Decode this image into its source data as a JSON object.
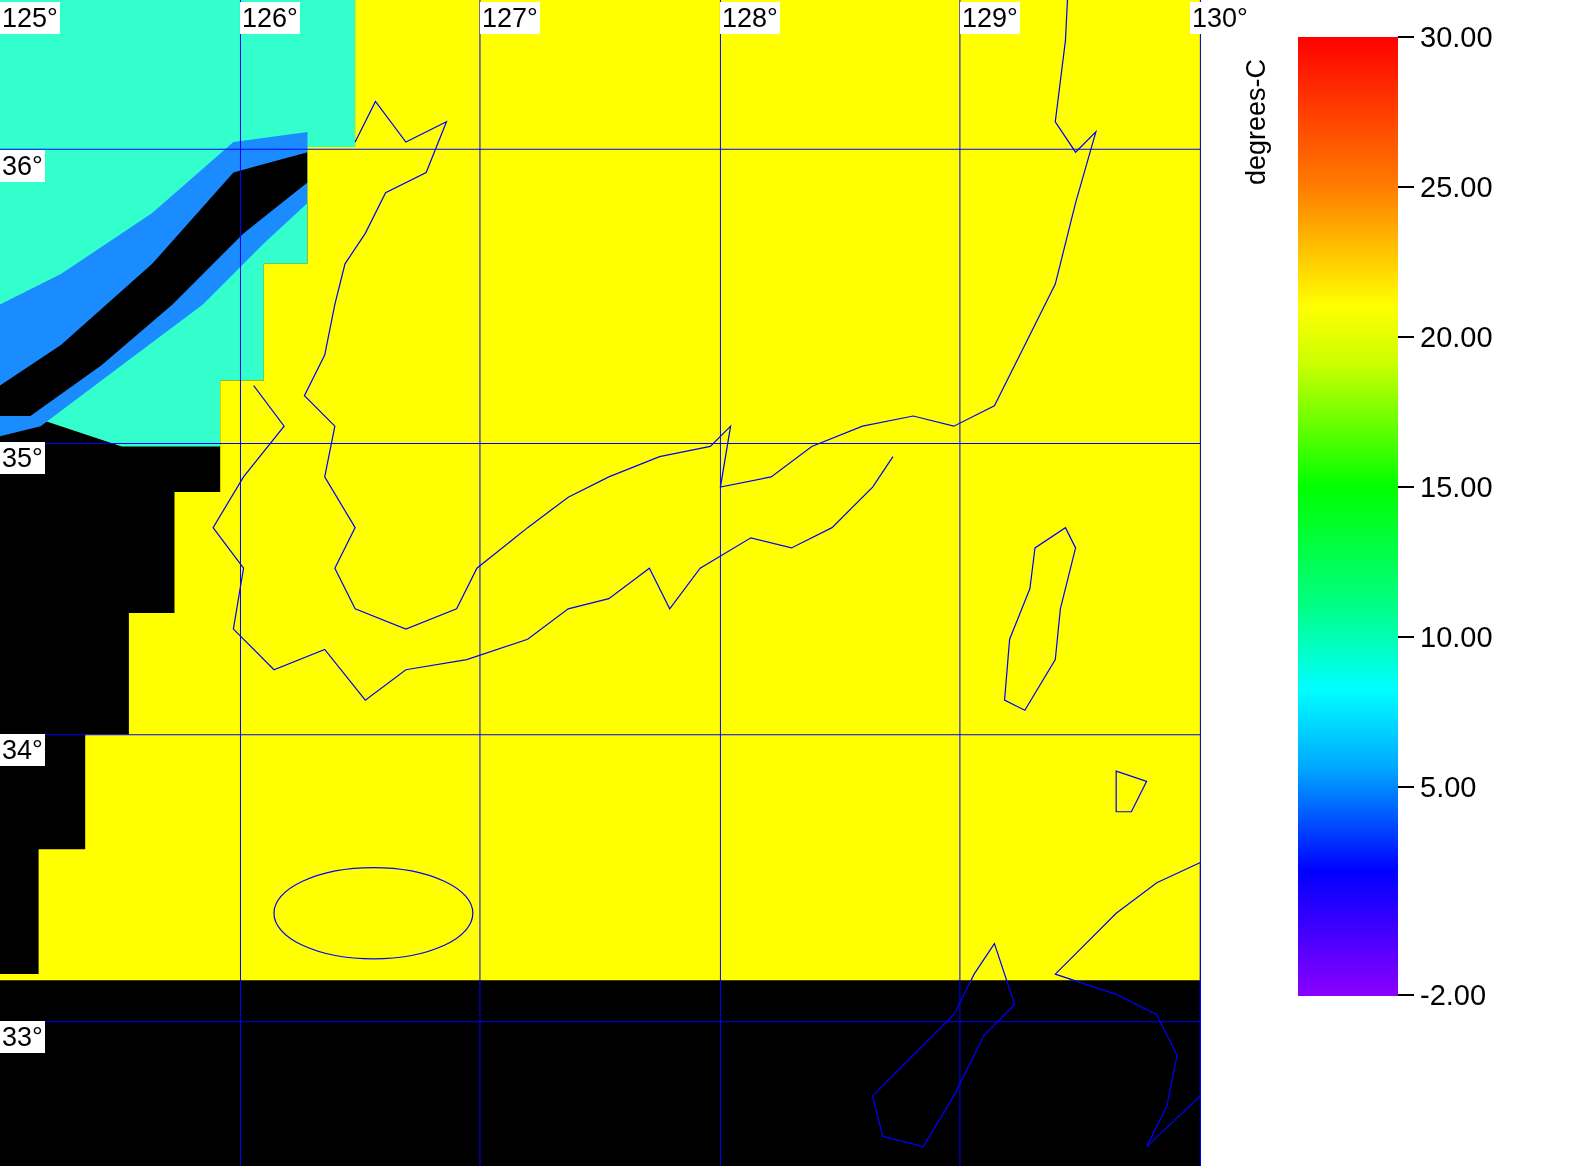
{
  "map": {
    "longitude_labels": [
      "125°",
      "126°",
      "127°",
      "128°",
      "129°",
      "130°"
    ],
    "latitude_labels": [
      "36°",
      "35°",
      "34°",
      "33°"
    ]
  },
  "colorbar": {
    "unit": "degrees-C",
    "ticks": [
      {
        "label": "30.00",
        "kind": "step"
      },
      {
        "label": "25.00",
        "kind": "step"
      },
      {
        "label": "20.00",
        "kind": "step"
      },
      {
        "label": "15.00",
        "kind": "step"
      },
      {
        "label": "10.00",
        "kind": "step"
      },
      {
        "label": "5.00",
        "kind": "step"
      },
      {
        "label": "-2.00",
        "kind": "end"
      }
    ]
  }
}
